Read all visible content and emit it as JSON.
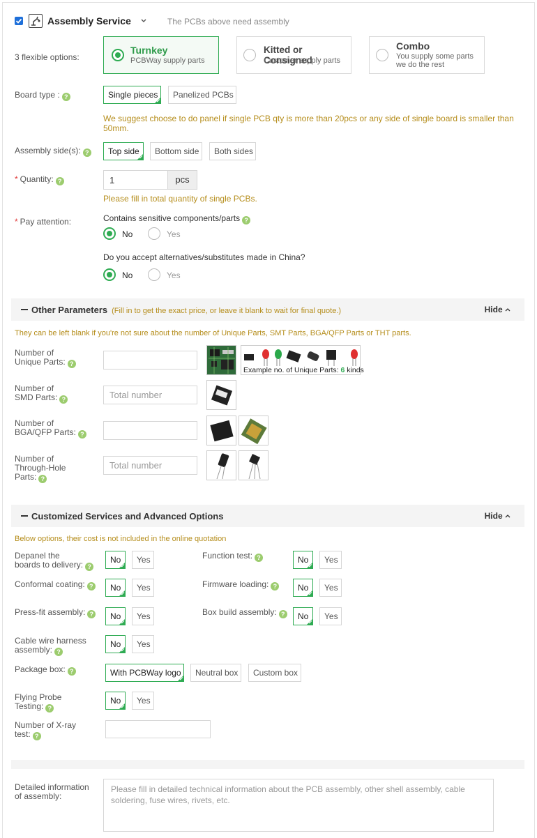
{
  "header": {
    "title": "Assembly Service",
    "subtitle": "The PCBs above need assembly"
  },
  "options_label": "3 flexible options:",
  "options": [
    {
      "title": "Turnkey",
      "sub": "PCBWay supply parts"
    },
    {
      "title": "Kitted or Consigned",
      "sub": "Customer supply parts"
    },
    {
      "title": "Combo",
      "sub1": "You supply some parts",
      "sub2": "we do the rest"
    }
  ],
  "board_type": {
    "label": "Board type :",
    "options": [
      "Single pieces",
      "Panelized PCBs"
    ],
    "note": "We suggest choose to do panel if single PCB qty is more than 20pcs or any side of single board is smaller than 50mm."
  },
  "assembly_side": {
    "label": "Assembly side(s):",
    "options": [
      "Top side",
      "Bottom side",
      "Both sides"
    ]
  },
  "quantity": {
    "label": "Quantity:",
    "value": "1",
    "unit": "pcs",
    "note": "Please fill in total quantity of single PCBs."
  },
  "pay_attention": {
    "label": "Pay attention:",
    "q1": "Contains sensitive components/parts",
    "q2": "Do you accept alternatives/substitutes made in China?",
    "no": "No",
    "yes": "Yes"
  },
  "other_params": {
    "title": "Other Parameters",
    "note": "(Fill in to get the exact price, or leave it blank to wait for final quote.)",
    "hide": "Hide",
    "hint": "They can be left blank if you're not sure about the number of Unique Parts, SMT Parts, BGA/QFP Parts or THT parts.",
    "unique": {
      "l1": "Number of",
      "l2": "Unique Parts:"
    },
    "example_pre": "Example no. of Unique Parts:",
    "example_num": "6",
    "example_post": "kinds",
    "smd": {
      "l1": "Number of",
      "l2": "SMD Parts:",
      "placeholder": "Total number"
    },
    "bga": {
      "l1": "Number of",
      "l2": "BGA/QFP Parts:"
    },
    "tht": {
      "l1": "Number of",
      "l2": "Through-Hole",
      "l3": "Parts:",
      "placeholder": "Total number"
    }
  },
  "custom": {
    "title": "Customized Services and Advanced Options",
    "hide": "Hide",
    "hint": "Below options, their cost is not included in the online quotation",
    "no": "No",
    "yes": "Yes",
    "depanel": {
      "l1": "Depanel the",
      "l2": "boards to delivery:"
    },
    "function_test": "Function test:",
    "conformal": "Conformal coating:",
    "firmware": "Firmware loading:",
    "pressfit": "Press-fit assembly:",
    "boxbuild": "Box build assembly:",
    "cable": {
      "l1": "Cable wire harness",
      "l2": "assembly:"
    },
    "package": {
      "label": "Package box:",
      "options": [
        "With PCBWay logo",
        "Neutral box",
        "Custom box"
      ]
    },
    "flying": {
      "l1": "Flying Probe",
      "l2": "Testing:"
    },
    "xray": {
      "l1": "Number of X-ray",
      "l2": "test:"
    }
  },
  "detail": {
    "l1": "Detailed information",
    "l2": "of assembly:",
    "placeholder": "Please fill in detailed technical information about the PCB assembly, other shell assembly, cable soldering, fuse wires, rivets, etc."
  },
  "colors": {
    "accent": "#2eab52",
    "warning": "#b58d1b",
    "required": "#e03a3a",
    "help": "#9ccc6e"
  }
}
